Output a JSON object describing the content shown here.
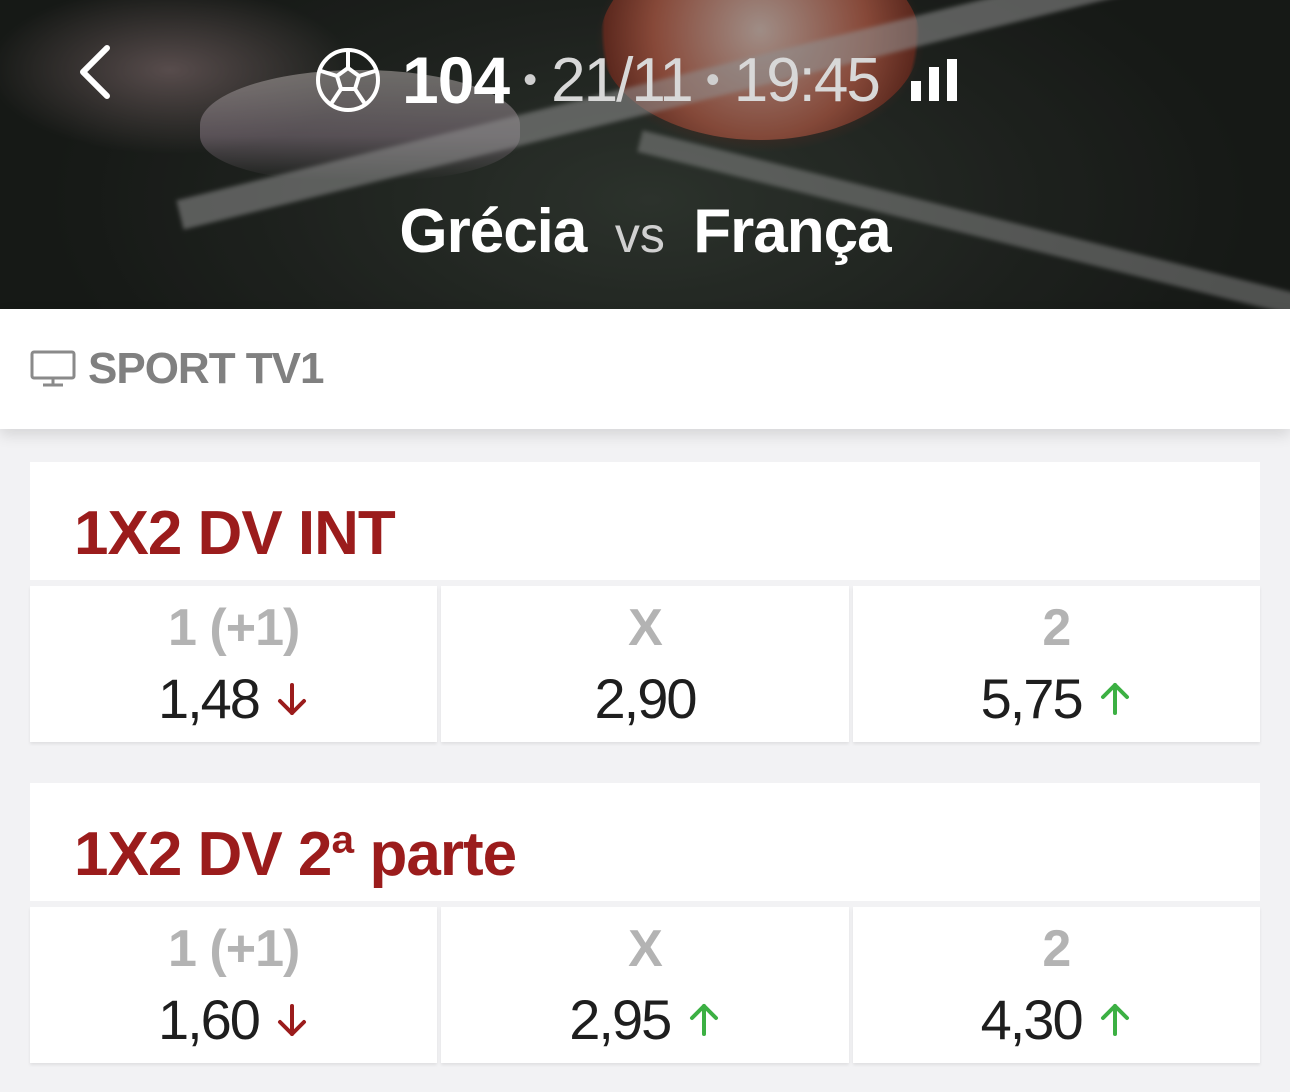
{
  "header": {
    "match_number": "104",
    "date": "21/11",
    "time": "19:45",
    "separator": "•",
    "home_team": "Grécia",
    "vs_label": "vs",
    "away_team": "França"
  },
  "channel": {
    "name": "SPORT TV1"
  },
  "markets": [
    {
      "title": "1X2 DV INT",
      "odds": [
        {
          "label": "1 (+1)",
          "value": "1,48",
          "trend": "down"
        },
        {
          "label": "X",
          "value": "2,90",
          "trend": "none"
        },
        {
          "label": "2",
          "value": "5,75",
          "trend": "up"
        }
      ]
    },
    {
      "title": "1X2 DV 2ª parte",
      "odds": [
        {
          "label": "1 (+1)",
          "value": "1,60",
          "trend": "down"
        },
        {
          "label": "X",
          "value": "2,95",
          "trend": "up"
        },
        {
          "label": "2",
          "value": "4,30",
          "trend": "up"
        }
      ]
    }
  ],
  "colors": {
    "accent": "#9b1c1c",
    "trend_up": "#3cb043",
    "trend_down": "#9b1c1c"
  }
}
